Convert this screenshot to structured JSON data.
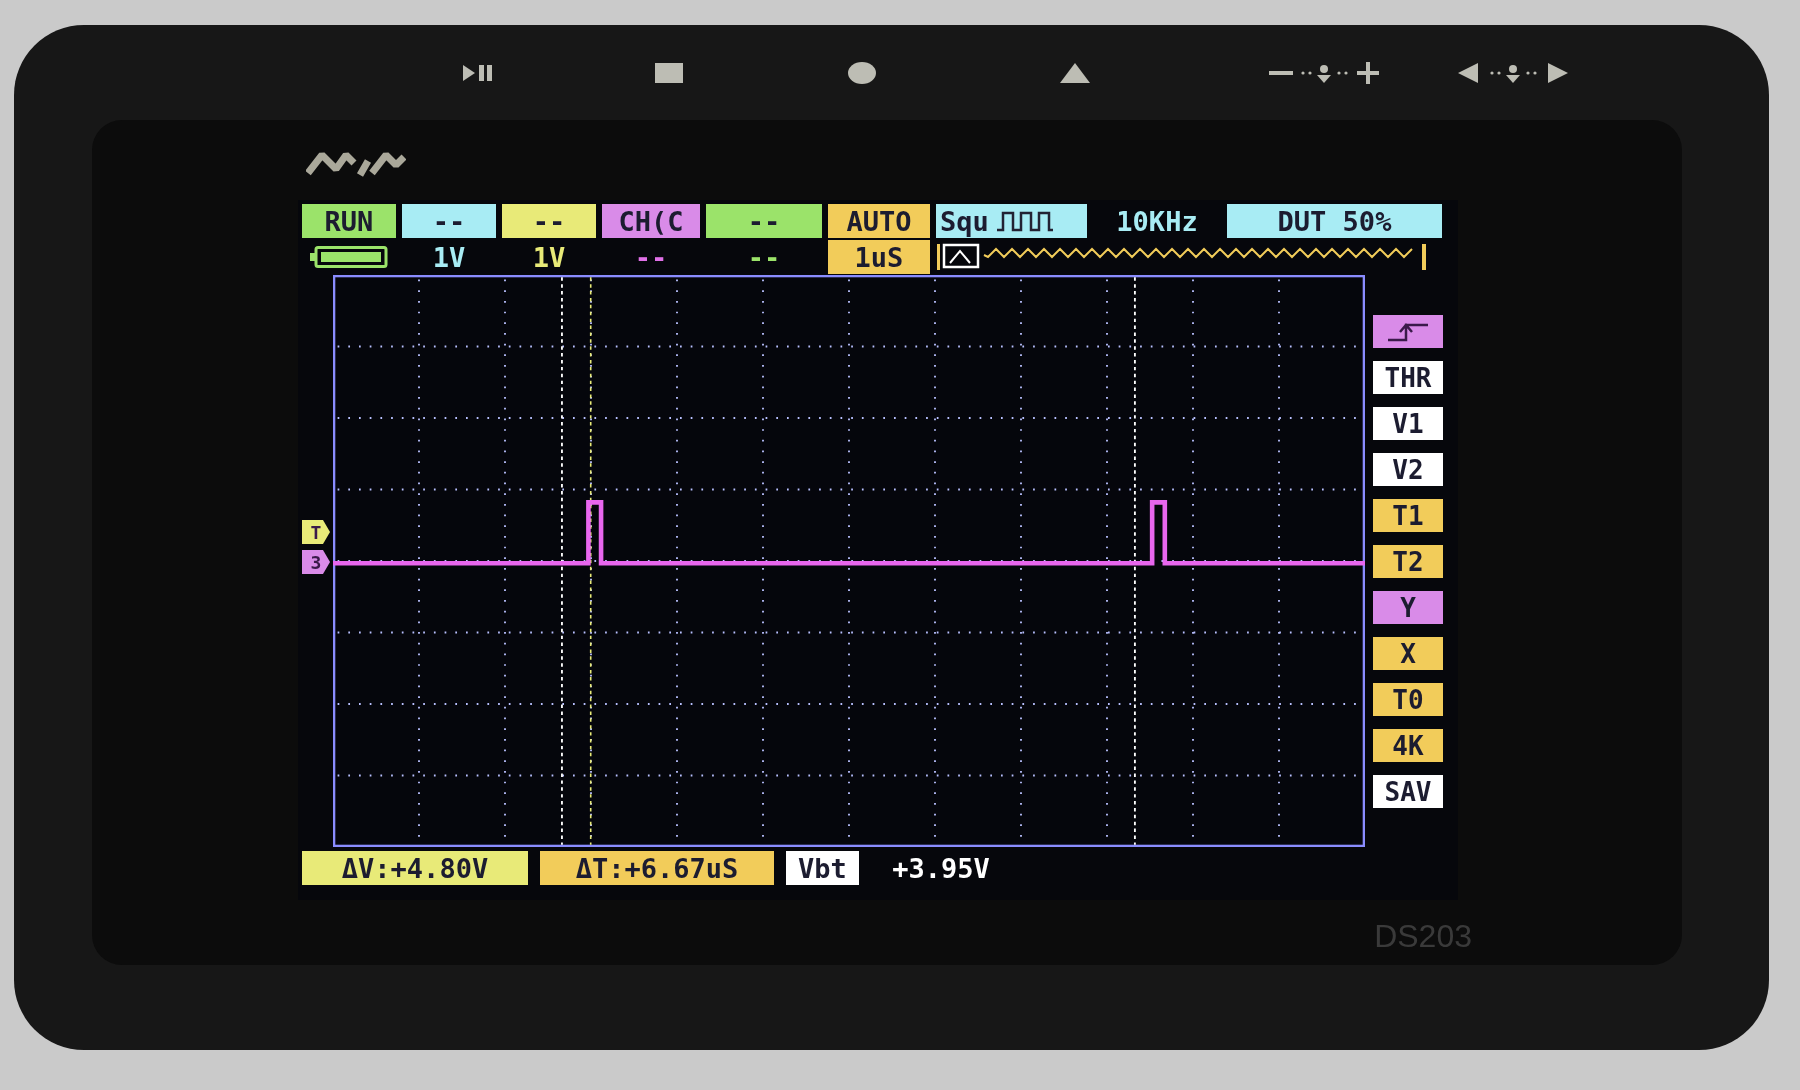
{
  "device": {
    "model": "DS203"
  },
  "status": [
    {
      "kind": "filled",
      "text": "RUN",
      "color": "#9be36a"
    },
    {
      "kind": "filled",
      "text": "--",
      "color": "#a8ecf4"
    },
    {
      "kind": "filled",
      "text": "--",
      "color": "#e8ea78"
    },
    {
      "kind": "filled",
      "text": "CH(C",
      "color": "#d98be8"
    },
    {
      "kind": "filled",
      "text": "--",
      "color": "#9be36a"
    },
    {
      "kind": "filled",
      "text": "AUTO",
      "color": "#f2cc5a"
    },
    {
      "kind": "wave",
      "text": "Squ",
      "color": "#a8ecf4"
    },
    {
      "kind": "plain",
      "text": "10KHz",
      "color": "#a8ecf4"
    },
    {
      "kind": "filled",
      "text": "DUT 50%",
      "color": "#a8ecf4"
    }
  ],
  "settings": [
    {
      "kind": "battery",
      "color": "#9be36a"
    },
    {
      "kind": "text",
      "text": "1V",
      "color": "#a8ecf4"
    },
    {
      "kind": "text",
      "text": "1V",
      "color": "#e8ea78"
    },
    {
      "kind": "text",
      "text": "--",
      "color": "#e070e8"
    },
    {
      "kind": "text",
      "text": "--",
      "color": "#9be36a"
    },
    {
      "kind": "filled",
      "text": "1uS",
      "color": "#f2cc5a"
    }
  ],
  "markers": [
    {
      "text": "T",
      "color": "#e8ea78"
    },
    {
      "text": "3",
      "color": "#d98be8"
    }
  ],
  "menu": [
    {
      "kind": "icon",
      "color": "#d98be8"
    },
    {
      "kind": "text",
      "text": "THR",
      "color": "#ffffff"
    },
    {
      "kind": "text",
      "text": "V1",
      "color": "#ffffff"
    },
    {
      "kind": "text",
      "text": "V2",
      "color": "#ffffff"
    },
    {
      "kind": "text",
      "text": "T1",
      "color": "#f2cc5a"
    },
    {
      "kind": "text",
      "text": "T2",
      "color": "#f2cc5a"
    },
    {
      "kind": "text",
      "text": "Y",
      "color": "#d98be8"
    },
    {
      "kind": "text",
      "text": "X",
      "color": "#f2cc5a"
    },
    {
      "kind": "text",
      "text": "T0",
      "color": "#f2cc5a"
    },
    {
      "kind": "text",
      "text": "4K",
      "color": "#f2cc5a"
    },
    {
      "kind": "text",
      "text": "SAV",
      "color": "#ffffff"
    }
  ],
  "readouts": [
    {
      "kind": "filled",
      "text": "ΔV:+4.80V",
      "color": "#e8ea78"
    },
    {
      "kind": "filled",
      "text": "ΔT:+6.67uS",
      "color": "#f2cc5a"
    },
    {
      "kind": "filled",
      "text": "Vbt",
      "color": "#ffffff"
    },
    {
      "kind": "plain",
      "text": "+3.95V",
      "color": "#ffffff"
    }
  ]
}
